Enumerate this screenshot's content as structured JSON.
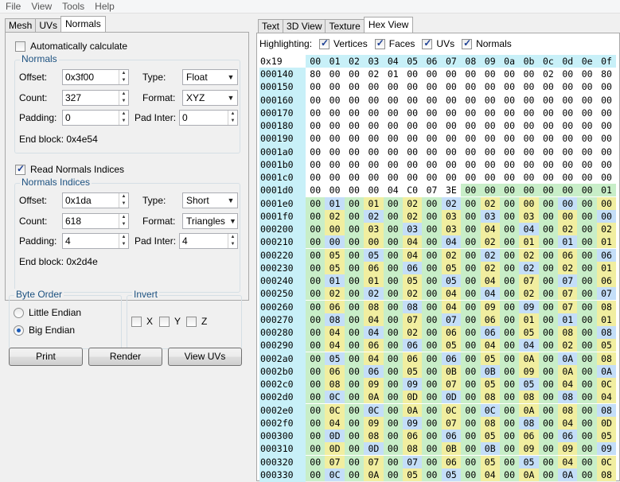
{
  "menu": [
    "File",
    "View",
    "Tools",
    "Help"
  ],
  "left_tabs": [
    "Mesh",
    "UVs",
    "Normals"
  ],
  "auto_calc": {
    "label": "Automatically calculate",
    "checked": false
  },
  "normals": {
    "title": "Normals",
    "offset_label": "Offset:",
    "offset": "0x3f00",
    "count_label": "Count:",
    "count": "327",
    "padding_label": "Padding:",
    "padding": "0",
    "type_label": "Type:",
    "type": "Float",
    "format_label": "Format:",
    "format": "XYZ",
    "padinter_label": "Pad Inter:",
    "padinter": "0",
    "endblock": "End block: 0x4e54"
  },
  "read_indices": {
    "label": "Read Normals Indices",
    "checked": true
  },
  "indices": {
    "title": "Normals Indices",
    "offset_label": "Offset:",
    "offset": "0x1da",
    "count_label": "Count:",
    "count": "618",
    "padding_label": "Padding:",
    "padding": "4",
    "type_label": "Type:",
    "type": "Short",
    "format_label": "Format:",
    "format": "Triangles",
    "padinter_label": "Pad Inter:",
    "padinter": "4",
    "endblock": "End block: 0x2d4e"
  },
  "byte_order": {
    "title": "Byte Order",
    "little": "Little Endian",
    "big": "Big Endian",
    "selected": "big"
  },
  "invert": {
    "title": "Invert",
    "x": "X",
    "y": "Y",
    "z": "Z"
  },
  "buttons": {
    "print": "Print",
    "render": "Render",
    "view_uvs": "View UVs"
  },
  "right_tabs": [
    "Text",
    "3D View",
    "Texture",
    "Hex View"
  ],
  "highlighting": {
    "label": "Highlighting:",
    "vertices": "Vertices",
    "faces": "Faces",
    "uvs": "UVs",
    "normals": "Normals"
  },
  "hex": {
    "corner": "0x19",
    "columns": [
      "00",
      "01",
      "02",
      "03",
      "04",
      "05",
      "06",
      "07",
      "08",
      "09",
      "0a",
      "0b",
      "0c",
      "0d",
      "0e",
      "0f"
    ],
    "rows": [
      {
        "addr": "000140",
        "bytes": [
          "80",
          "00",
          "00",
          "02",
          "01",
          "00",
          "00",
          "00",
          "00",
          "00",
          "00",
          "00",
          "02",
          "00",
          "00",
          "80"
        ]
      },
      {
        "addr": "000150",
        "bytes": [
          "00",
          "00",
          "00",
          "00",
          "00",
          "00",
          "00",
          "00",
          "00",
          "00",
          "00",
          "00",
          "00",
          "00",
          "00",
          "00"
        ]
      },
      {
        "addr": "000160",
        "bytes": [
          "00",
          "00",
          "00",
          "00",
          "00",
          "00",
          "00",
          "00",
          "00",
          "00",
          "00",
          "00",
          "00",
          "00",
          "00",
          "00"
        ]
      },
      {
        "addr": "000170",
        "bytes": [
          "00",
          "00",
          "00",
          "00",
          "00",
          "00",
          "00",
          "00",
          "00",
          "00",
          "00",
          "00",
          "00",
          "00",
          "00",
          "00"
        ]
      },
      {
        "addr": "000180",
        "bytes": [
          "00",
          "00",
          "00",
          "00",
          "00",
          "00",
          "00",
          "00",
          "00",
          "00",
          "00",
          "00",
          "00",
          "00",
          "00",
          "00"
        ]
      },
      {
        "addr": "000190",
        "bytes": [
          "00",
          "00",
          "00",
          "00",
          "00",
          "00",
          "00",
          "00",
          "00",
          "00",
          "00",
          "00",
          "00",
          "00",
          "00",
          "00"
        ]
      },
      {
        "addr": "0001a0",
        "bytes": [
          "00",
          "00",
          "00",
          "00",
          "00",
          "00",
          "00",
          "00",
          "00",
          "00",
          "00",
          "00",
          "00",
          "00",
          "00",
          "00"
        ]
      },
      {
        "addr": "0001b0",
        "bytes": [
          "00",
          "00",
          "00",
          "00",
          "00",
          "00",
          "00",
          "00",
          "00",
          "00",
          "00",
          "00",
          "00",
          "00",
          "00",
          "00"
        ]
      },
      {
        "addr": "0001c0",
        "bytes": [
          "00",
          "00",
          "00",
          "00",
          "00",
          "00",
          "00",
          "00",
          "00",
          "00",
          "00",
          "00",
          "00",
          "00",
          "00",
          "00"
        ]
      },
      {
        "addr": "0001d0",
        "bytes": [
          "00",
          "00",
          "00",
          "00",
          "04",
          "C0",
          "07",
          "3E",
          "00",
          "00",
          "00",
          "00",
          "00",
          "00",
          "00",
          "01"
        ]
      },
      {
        "addr": "0001e0",
        "bytes": [
          "00",
          "01",
          "00",
          "01",
          "00",
          "02",
          "00",
          "02",
          "00",
          "02",
          "00",
          "00",
          "00",
          "00",
          "00",
          "00"
        ]
      },
      {
        "addr": "0001f0",
        "bytes": [
          "00",
          "02",
          "00",
          "02",
          "00",
          "02",
          "00",
          "03",
          "00",
          "03",
          "00",
          "03",
          "00",
          "00",
          "00",
          "00"
        ]
      },
      {
        "addr": "000200",
        "bytes": [
          "00",
          "00",
          "00",
          "03",
          "00",
          "03",
          "00",
          "03",
          "00",
          "04",
          "00",
          "04",
          "00",
          "02",
          "00",
          "02"
        ]
      },
      {
        "addr": "000210",
        "bytes": [
          "00",
          "00",
          "00",
          "00",
          "00",
          "04",
          "00",
          "04",
          "00",
          "02",
          "00",
          "01",
          "00",
          "01",
          "00",
          "01"
        ]
      },
      {
        "addr": "000220",
        "bytes": [
          "00",
          "05",
          "00",
          "05",
          "00",
          "04",
          "00",
          "02",
          "00",
          "02",
          "00",
          "02",
          "00",
          "06",
          "00",
          "06"
        ]
      },
      {
        "addr": "000230",
        "bytes": [
          "00",
          "05",
          "00",
          "06",
          "00",
          "06",
          "00",
          "05",
          "00",
          "02",
          "00",
          "02",
          "00",
          "02",
          "00",
          "01"
        ]
      },
      {
        "addr": "000240",
        "bytes": [
          "00",
          "01",
          "00",
          "01",
          "00",
          "05",
          "00",
          "05",
          "00",
          "04",
          "00",
          "07",
          "00",
          "07",
          "00",
          "06"
        ]
      },
      {
        "addr": "000250",
        "bytes": [
          "00",
          "02",
          "00",
          "02",
          "00",
          "02",
          "00",
          "04",
          "00",
          "04",
          "00",
          "02",
          "00",
          "07",
          "00",
          "07"
        ]
      },
      {
        "addr": "000260",
        "bytes": [
          "00",
          "06",
          "00",
          "08",
          "00",
          "08",
          "00",
          "04",
          "00",
          "09",
          "00",
          "09",
          "00",
          "07",
          "00",
          "08"
        ]
      },
      {
        "addr": "000270",
        "bytes": [
          "00",
          "08",
          "00",
          "04",
          "00",
          "07",
          "00",
          "07",
          "00",
          "06",
          "00",
          "01",
          "00",
          "01",
          "00",
          "01"
        ]
      },
      {
        "addr": "000280",
        "bytes": [
          "00",
          "04",
          "00",
          "04",
          "00",
          "02",
          "00",
          "06",
          "00",
          "06",
          "00",
          "05",
          "00",
          "08",
          "00",
          "08"
        ]
      },
      {
        "addr": "000290",
        "bytes": [
          "00",
          "04",
          "00",
          "06",
          "00",
          "06",
          "00",
          "05",
          "00",
          "04",
          "00",
          "04",
          "00",
          "02",
          "00",
          "05"
        ]
      },
      {
        "addr": "0002a0",
        "bytes": [
          "00",
          "05",
          "00",
          "04",
          "00",
          "06",
          "00",
          "06",
          "00",
          "05",
          "00",
          "0A",
          "00",
          "0A",
          "00",
          "08"
        ]
      },
      {
        "addr": "0002b0",
        "bytes": [
          "00",
          "06",
          "00",
          "06",
          "00",
          "05",
          "00",
          "0B",
          "00",
          "0B",
          "00",
          "09",
          "00",
          "0A",
          "00",
          "0A"
        ]
      },
      {
        "addr": "0002c0",
        "bytes": [
          "00",
          "08",
          "00",
          "09",
          "00",
          "09",
          "00",
          "07",
          "00",
          "05",
          "00",
          "05",
          "00",
          "04",
          "00",
          "0C"
        ]
      },
      {
        "addr": "0002d0",
        "bytes": [
          "00",
          "0C",
          "00",
          "0A",
          "00",
          "0D",
          "00",
          "0D",
          "00",
          "08",
          "00",
          "08",
          "00",
          "08",
          "00",
          "04"
        ]
      },
      {
        "addr": "0002e0",
        "bytes": [
          "00",
          "0C",
          "00",
          "0C",
          "00",
          "0A",
          "00",
          "0C",
          "00",
          "0C",
          "00",
          "0A",
          "00",
          "08",
          "00",
          "08"
        ]
      },
      {
        "addr": "0002f0",
        "bytes": [
          "00",
          "04",
          "00",
          "09",
          "00",
          "09",
          "00",
          "07",
          "00",
          "08",
          "00",
          "08",
          "00",
          "04",
          "00",
          "0D"
        ]
      },
      {
        "addr": "000300",
        "bytes": [
          "00",
          "0D",
          "00",
          "08",
          "00",
          "06",
          "00",
          "06",
          "00",
          "05",
          "00",
          "06",
          "00",
          "06",
          "00",
          "05"
        ]
      },
      {
        "addr": "000310",
        "bytes": [
          "00",
          "0D",
          "00",
          "0D",
          "00",
          "08",
          "00",
          "0B",
          "00",
          "0B",
          "00",
          "09",
          "00",
          "09",
          "00",
          "09"
        ]
      },
      {
        "addr": "000320",
        "bytes": [
          "00",
          "07",
          "00",
          "07",
          "00",
          "07",
          "00",
          "06",
          "00",
          "05",
          "00",
          "05",
          "00",
          "04",
          "00",
          "0C"
        ]
      },
      {
        "addr": "000330",
        "bytes": [
          "00",
          "0C",
          "00",
          "0A",
          "00",
          "05",
          "00",
          "05",
          "00",
          "04",
          "00",
          "0A",
          "00",
          "0A",
          "00",
          "08"
        ]
      }
    ]
  }
}
